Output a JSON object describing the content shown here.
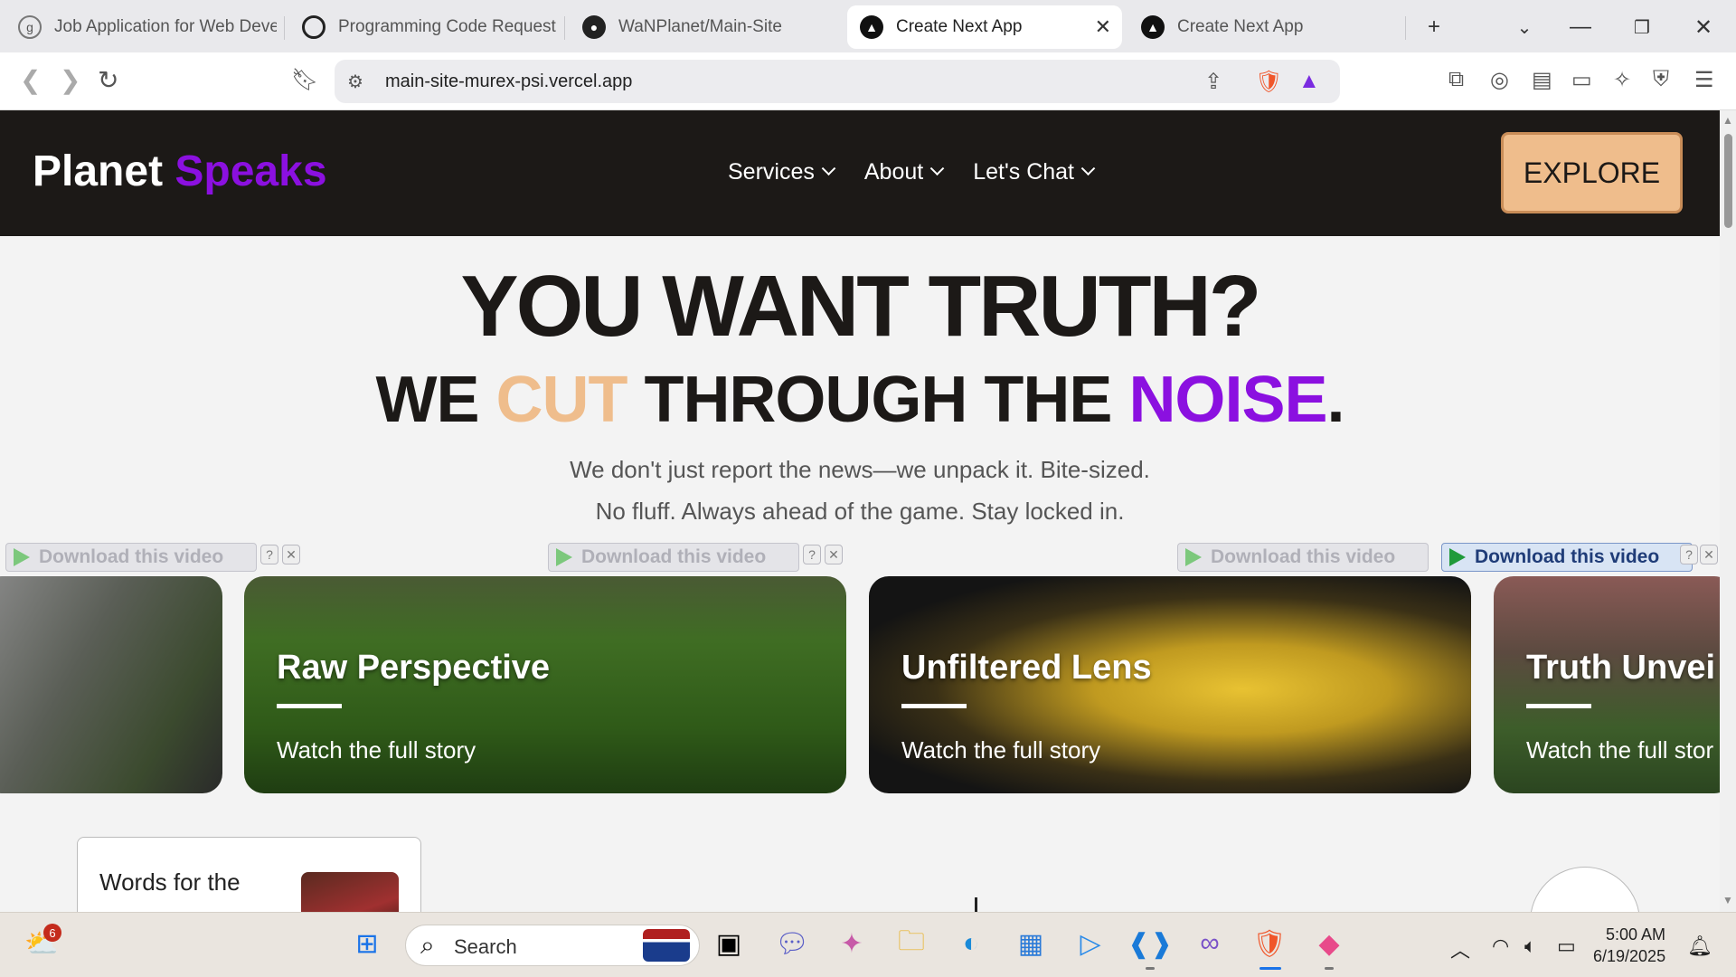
{
  "browser": {
    "tabs": [
      {
        "title": "Job Application for Web Deve",
        "icon": "gemini-icon"
      },
      {
        "title": "Programming Code Request",
        "icon": "chatgpt-icon"
      },
      {
        "title": "WaNPlanet/Main-Site",
        "icon": "github-icon"
      },
      {
        "title": "Create Next App",
        "icon": "nextjs-icon",
        "active": true
      },
      {
        "title": "Create Next App",
        "icon": "nextjs-icon"
      }
    ],
    "url": "main-site-murex-psi.vercel.app"
  },
  "site": {
    "logo": {
      "part1": "Planet",
      "part2": "Speaks"
    },
    "nav": [
      {
        "label": "Services"
      },
      {
        "label": "About"
      },
      {
        "label": "Let's Chat"
      }
    ],
    "explore_label": "EXPLORE",
    "hero": {
      "line1": "YOU WANT TRUTH?",
      "line2_a": "WE ",
      "line2_cut": "CUT",
      "line2_b": " THROUGH THE ",
      "line2_noise": "NOISE",
      "line2_end": ".",
      "sub1": "We don't just report the news—we unpack it. Bite-sized.",
      "sub2": "No fluff. Always ahead of the game. Stay locked in."
    },
    "download_label": "Download this video",
    "download_help": "?",
    "download_close": "✕",
    "cards": [
      {
        "title": "",
        "subtitle": ""
      },
      {
        "title": "Raw Perspective",
        "subtitle": "Watch the full story"
      },
      {
        "title": "Unfiltered Lens",
        "subtitle": "Watch the full story"
      },
      {
        "title": "Truth Unvei",
        "subtitle": "Watch the full stor"
      }
    ],
    "lower_card": {
      "text": "Words for the"
    }
  },
  "taskbar": {
    "search_label": "Search",
    "weather_badge": "6",
    "time": "5:00 AM",
    "date": "6/19/2025"
  },
  "colors": {
    "brand_purple": "#8b10e0",
    "accent_peach": "#efbd8c",
    "header_dark": "#1c1917"
  }
}
